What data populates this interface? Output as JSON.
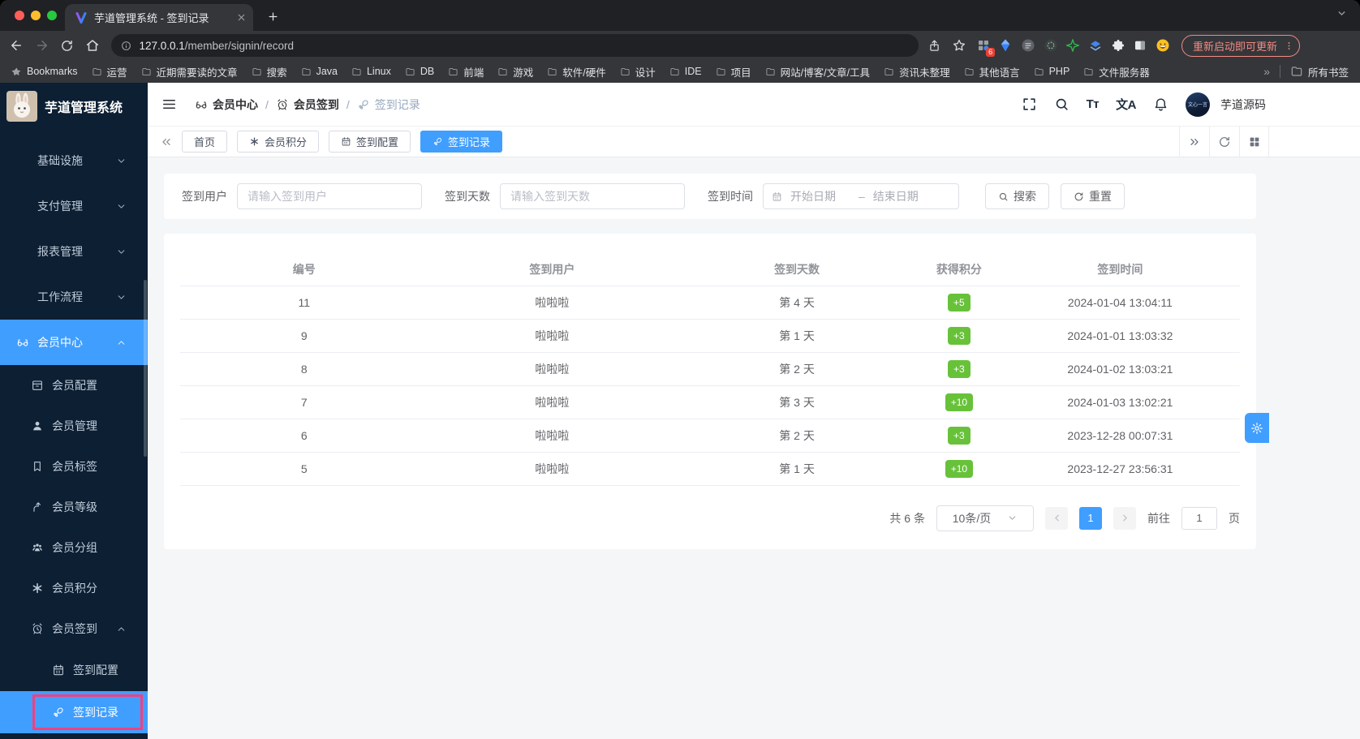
{
  "colors": {
    "accent": "#409eff",
    "success": "#67c23a",
    "annotation": "#f2407f",
    "sidebar_bg": "#0c1f33"
  },
  "browser": {
    "tab_title": "芋道管理系统 - 签到记录",
    "url_host": "127.0.0.1",
    "url_path": "/member/signin/record",
    "update_button": "重新启动即可更新",
    "extension_badge": "6",
    "bookmarks_bar": {
      "items": [
        {
          "icon": "star-icon",
          "label": "Bookmarks"
        },
        {
          "icon": "folder-icon",
          "label": "运营"
        },
        {
          "icon": "folder-icon",
          "label": "近期需要读的文章"
        },
        {
          "icon": "folder-icon",
          "label": "搜索"
        },
        {
          "icon": "folder-icon",
          "label": "Java"
        },
        {
          "icon": "folder-icon",
          "label": "Linux"
        },
        {
          "icon": "folder-icon",
          "label": "DB"
        },
        {
          "icon": "folder-icon",
          "label": "前端"
        },
        {
          "icon": "folder-icon",
          "label": "游戏"
        },
        {
          "icon": "folder-icon",
          "label": "软件/硬件"
        },
        {
          "icon": "folder-icon",
          "label": "设计"
        },
        {
          "icon": "folder-icon",
          "label": "IDE"
        },
        {
          "icon": "folder-icon",
          "label": "项目"
        },
        {
          "icon": "folder-icon",
          "label": "网站/博客/文章/工具"
        },
        {
          "icon": "folder-icon",
          "label": "资讯未整理"
        },
        {
          "icon": "folder-icon",
          "label": "其他语言"
        },
        {
          "icon": "folder-icon",
          "label": "PHP"
        },
        {
          "icon": "folder-icon",
          "label": "文件服务器"
        }
      ],
      "overflow": "»",
      "all_bookmarks": "所有书签"
    }
  },
  "app": {
    "logo_title": "芋道管理系统",
    "header": {
      "breadcrumb": [
        {
          "icon": "glasses-icon",
          "label": "会员中心"
        },
        {
          "icon": "alarm-icon",
          "label": "会员签到"
        },
        {
          "icon": "key-icon",
          "label": "签到记录",
          "muted": true
        }
      ],
      "separator": "/",
      "font_size_tool": "Tт",
      "translate_tool": "文A",
      "avatar_text": "文心一言",
      "username": "芋道源码"
    },
    "sidebar": {
      "items": [
        {
          "type": "group",
          "label": "基础设施",
          "chevron": "down"
        },
        {
          "type": "group",
          "label": "支付管理",
          "chevron": "down"
        },
        {
          "type": "group",
          "label": "报表管理",
          "chevron": "down"
        },
        {
          "type": "group",
          "label": "工作流程",
          "chevron": "down"
        },
        {
          "type": "group",
          "label": "会员中心",
          "icon": "glasses-icon",
          "chevron": "up",
          "active": true
        },
        {
          "type": "sub",
          "label": "会员配置",
          "icon": "box-icon"
        },
        {
          "type": "sub",
          "label": "会员管理",
          "icon": "user-icon"
        },
        {
          "type": "sub",
          "label": "会员标签",
          "icon": "bookmark-icon"
        },
        {
          "type": "sub",
          "label": "会员等级",
          "icon": "level-icon"
        },
        {
          "type": "sub",
          "label": "会员分组",
          "icon": "group-icon"
        },
        {
          "type": "sub",
          "label": "会员积分",
          "icon": "asterisk-icon"
        },
        {
          "type": "sub",
          "label": "会员签到",
          "icon": "alarm-icon",
          "chevron": "up"
        },
        {
          "type": "subsub",
          "label": "签到配置",
          "icon": "calendar-icon"
        },
        {
          "type": "subsub",
          "label": "签到记录",
          "icon": "key-icon",
          "active": true,
          "annotated": true
        }
      ]
    },
    "tags_bar": {
      "tabs": [
        {
          "label": "首页"
        },
        {
          "label": "会员积分",
          "icon": "asterisk-icon"
        },
        {
          "label": "签到配置",
          "icon": "calendar-icon"
        },
        {
          "label": "签到记录",
          "icon": "key-icon",
          "active": true
        }
      ]
    },
    "filter": {
      "user_label": "签到用户",
      "user_placeholder": "请输入签到用户",
      "days_label": "签到天数",
      "days_placeholder": "请输入签到天数",
      "time_label": "签到时间",
      "date_start_placeholder": "开始日期",
      "date_separator": "–",
      "date_end_placeholder": "结束日期",
      "search_button": "搜索",
      "reset_button": "重置"
    },
    "table": {
      "headers": [
        "编号",
        "签到用户",
        "签到天数",
        "获得积分",
        "签到时间"
      ],
      "rows": [
        {
          "id": "11",
          "user": "啦啦啦",
          "day": "第 4 天",
          "points": "+5",
          "time": "2024-01-04 13:04:11"
        },
        {
          "id": "9",
          "user": "啦啦啦",
          "day": "第 1 天",
          "points": "+3",
          "time": "2024-01-01 13:03:32"
        },
        {
          "id": "8",
          "user": "啦啦啦",
          "day": "第 2 天",
          "points": "+3",
          "time": "2024-01-02 13:03:21"
        },
        {
          "id": "7",
          "user": "啦啦啦",
          "day": "第 3 天",
          "points": "+10",
          "time": "2024-01-03 13:02:21"
        },
        {
          "id": "6",
          "user": "啦啦啦",
          "day": "第 2 天",
          "points": "+3",
          "time": "2023-12-28 00:07:31"
        },
        {
          "id": "5",
          "user": "啦啦啦",
          "day": "第 1 天",
          "points": "+10",
          "time": "2023-12-27 23:56:31"
        }
      ]
    },
    "pagination": {
      "total": "共 6 条",
      "page_size": "10条/页",
      "current_page": "1",
      "goto_label": "前往",
      "goto_value": "1",
      "page_unit": "页"
    }
  }
}
